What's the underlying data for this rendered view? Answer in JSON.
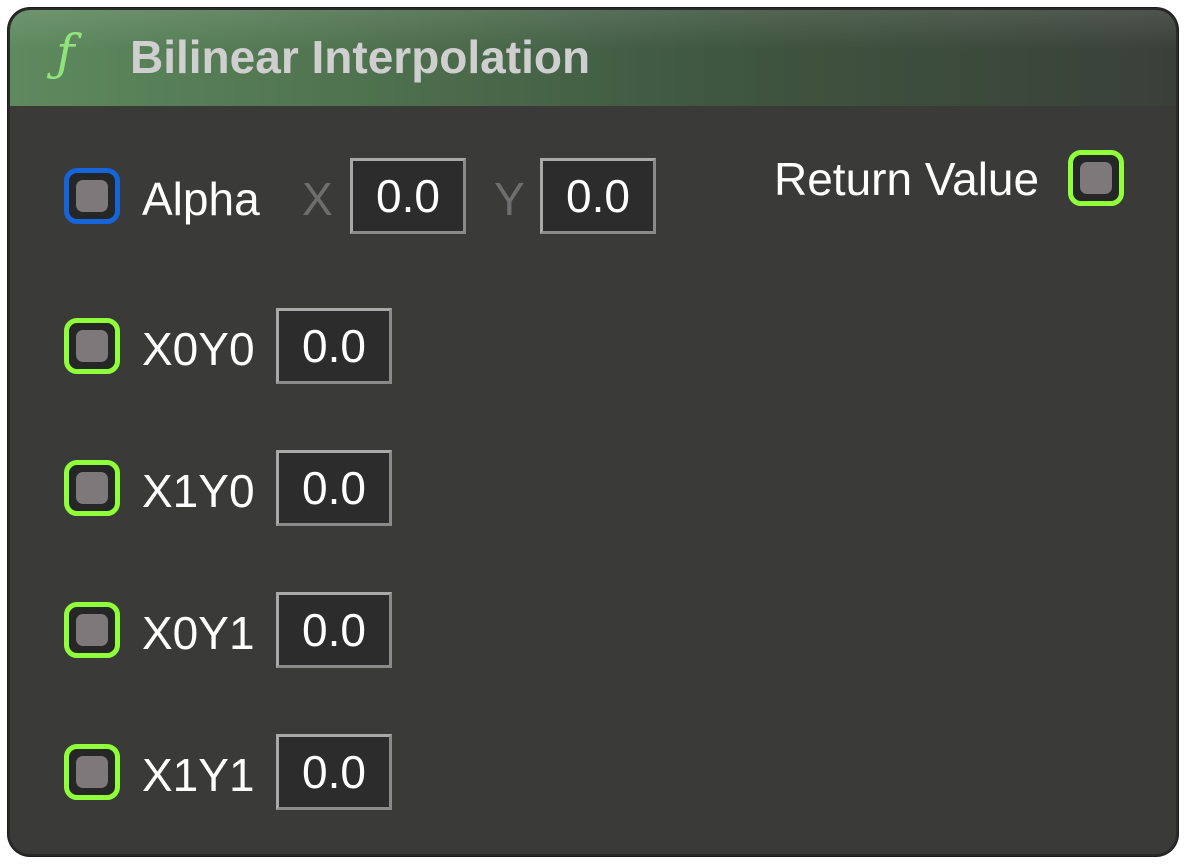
{
  "node": {
    "icon": "function-icon",
    "icon_glyph": "ƒ",
    "title": "Bilinear Interpolation",
    "header_color": "#5e8a5e",
    "body_color": "#3a3a39"
  },
  "inputs": {
    "alpha": {
      "label": "Alpha",
      "pin_color": "#1664d9",
      "x_label": "X",
      "x_value": "0.0",
      "y_label": "Y",
      "y_value": "0.0"
    },
    "x0y0": {
      "label": "X0Y0",
      "value": "0.0",
      "pin_color": "#8fff3a"
    },
    "x1y0": {
      "label": "X1Y0",
      "value": "0.0",
      "pin_color": "#8fff3a"
    },
    "x0y1": {
      "label": "X0Y1",
      "value": "0.0",
      "pin_color": "#8fff3a"
    },
    "x1y1": {
      "label": "X1Y1",
      "value": "0.0",
      "pin_color": "#8fff3a"
    }
  },
  "outputs": {
    "return_value": {
      "label": "Return Value",
      "pin_color": "#8fff3a"
    }
  }
}
